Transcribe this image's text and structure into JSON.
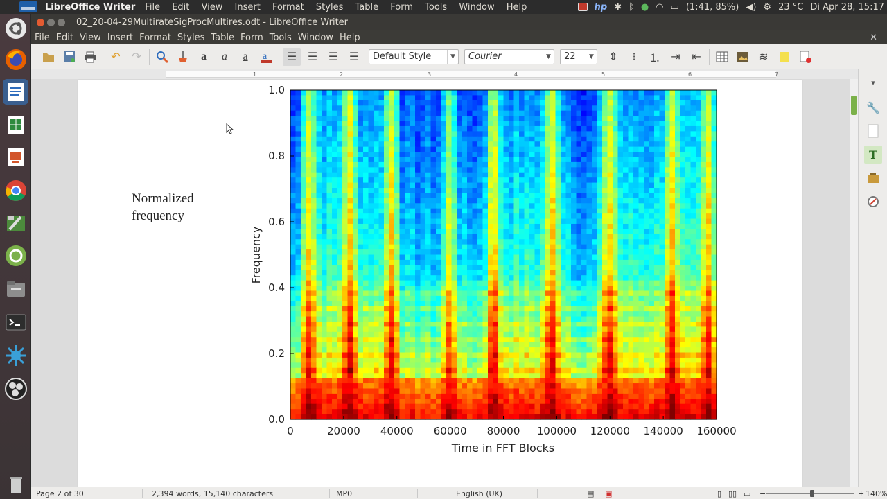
{
  "panel": {
    "app_name": "LibreOffice Writer",
    "menu": [
      "File",
      "Edit",
      "View",
      "Insert",
      "Format",
      "Styles",
      "Table",
      "Form",
      "Tools",
      "Window",
      "Help"
    ],
    "battery": "(1:41, 85%)",
    "weather": "23 °C",
    "datetime": "Di Apr 28, 15:17"
  },
  "window": {
    "title": "02_20-04-29MultirateSigProcMultires.odt - LibreOffice Writer"
  },
  "menubar": [
    "File",
    "Edit",
    "View",
    "Insert",
    "Format",
    "Styles",
    "Table",
    "Form",
    "Tools",
    "Window",
    "Help"
  ],
  "toolbar": {
    "paragraph_style": "Default Style",
    "font_name": "Courier",
    "font_size": "22"
  },
  "ruler": {
    "numbers": [
      "1",
      "2",
      "3",
      "4",
      "5",
      "6",
      "7"
    ]
  },
  "document": {
    "side_label_line1": "Normalized",
    "side_label_line2": "frequency"
  },
  "chart_data": {
    "type": "heatmap",
    "title": "",
    "xlabel": "Time in FFT Blocks",
    "ylabel": "Frequency",
    "xlim": [
      0,
      160000
    ],
    "ylim": [
      0.0,
      1.0
    ],
    "x_ticks": [
      "0",
      "20000",
      "40000",
      "60000",
      "80000",
      "100000",
      "120000",
      "140000",
      "160000"
    ],
    "y_ticks": [
      "0.0",
      "0.2",
      "0.4",
      "0.6",
      "0.8",
      "1.0"
    ],
    "colormap": "jet",
    "description_values": {
      "low_freq_band_top": 0.12,
      "harmonic_region_top": 0.42,
      "high_energy_columns_x": [
        7000,
        22000,
        38000,
        60000,
        76000,
        98000,
        120000,
        143000,
        157000
      ],
      "quiet_regions_x": [
        [
          40000,
          75000
        ],
        [
          105000,
          115000
        ]
      ]
    }
  },
  "statusbar": {
    "page": "Page 2 of 30",
    "words": "2,394 words, 15,140 characters",
    "mode": "MP0",
    "language": "English (UK)",
    "zoom": "140%"
  },
  "colors": {
    "panel_bg": "#2c2c2c",
    "toolbar_bg": "#edecea",
    "launcher_bg": "#4a3b3f",
    "accent_green": "#7bb14a"
  }
}
